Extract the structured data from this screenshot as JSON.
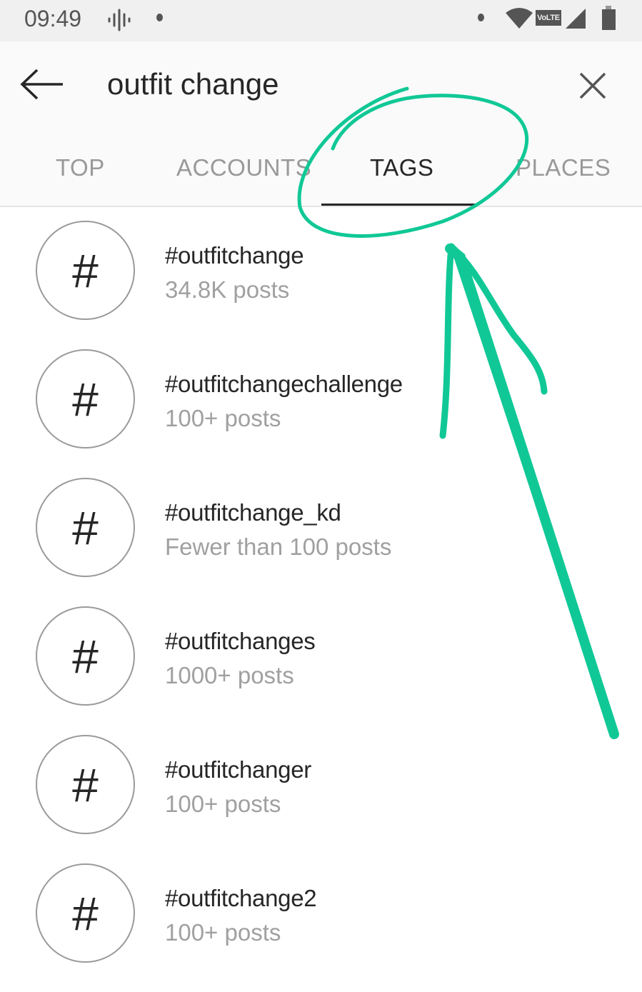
{
  "status_bar": {
    "time": "09:49",
    "network": "VoLTE"
  },
  "search": {
    "query": "outfit change"
  },
  "tabs": [
    {
      "label": "TOP"
    },
    {
      "label": "ACCOUNTS"
    },
    {
      "label": "TAGS",
      "active": true
    },
    {
      "label": "PLACES"
    }
  ],
  "results": [
    {
      "tag": "#outfitchange",
      "posts": "34.8K posts"
    },
    {
      "tag": "#outfitchangechallenge",
      "posts": "100+ posts"
    },
    {
      "tag": "#outfitchange_kd",
      "posts": "Fewer than 100 posts"
    },
    {
      "tag": "#outfitchanges",
      "posts": "1000+ posts"
    },
    {
      "tag": "#outfitchanger",
      "posts": "100+ posts"
    },
    {
      "tag": "#outfitchange2",
      "posts": "100+ posts"
    }
  ],
  "hash_symbol": "#",
  "annotation_color": "#10c896"
}
